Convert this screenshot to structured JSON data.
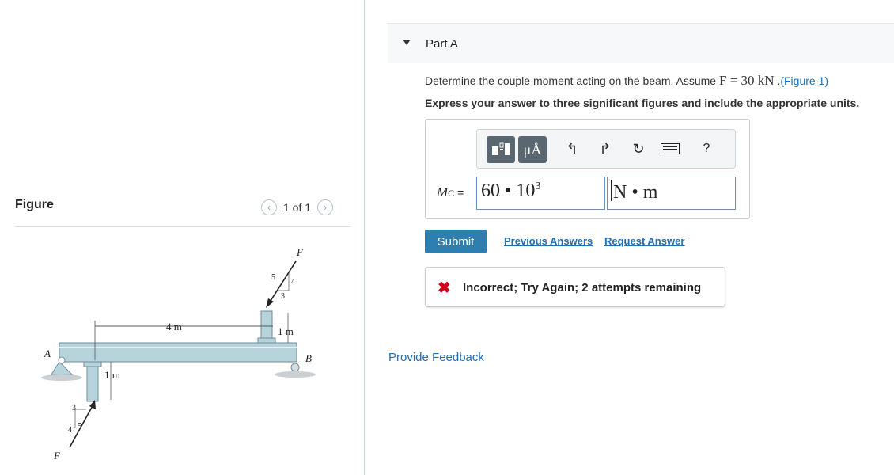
{
  "figure_panel": {
    "title": "Figure",
    "pager_text": "1 of 1",
    "prev_icon": "chevron-left-icon",
    "next_icon": "chevron-right-icon",
    "labels": {
      "force_top": "F",
      "force_bottom": "F",
      "top_slope_hyp": "5",
      "top_slope_rise": "4",
      "top_slope_run": "3",
      "bottom_slope_hyp": "5",
      "bottom_slope_rise": "4",
      "bottom_slope_run": "3",
      "span_length": "4 m",
      "top_arm": "1 m",
      "bottom_arm": "1 m",
      "support_a": "A",
      "support_b": "B"
    }
  },
  "part": {
    "title": "Part A",
    "caret_icon": "caret-down-icon"
  },
  "question": {
    "text_before": "Determine the couple moment acting on the beam. Assume ",
    "math": "F = 30 kN",
    "text_between": " .",
    "figure_link": "(Figure 1)",
    "instruction": "Express your answer to three significant figures and include the appropriate units."
  },
  "answer": {
    "label_main": "M",
    "label_sub": "C",
    "label_eq": " =",
    "value_mantissa": "60",
    "value_dot": " • ",
    "value_base": "10",
    "value_exp": "3",
    "unit": "N • m",
    "toolbar": {
      "template_icon": "template-icon",
      "units_label": "μÅ",
      "undo_icon": "undo-icon",
      "redo_icon": "redo-icon",
      "reset_icon": "reset-icon",
      "keyboard_icon": "keyboard-icon",
      "help_label": "?"
    }
  },
  "actions": {
    "submit": "Submit",
    "previous_answers": "Previous Answers",
    "request_answer": "Request Answer"
  },
  "feedback": {
    "status": "Incorrect; Try Again; 2 attempts remaining",
    "icon": "x-icon",
    "color": "#d0021b"
  },
  "footer": {
    "provide_feedback": "Provide Feedback"
  },
  "colors": {
    "accent": "#2e7fb0",
    "link": "#1f6fb5",
    "beam": "#b7d3dc"
  }
}
